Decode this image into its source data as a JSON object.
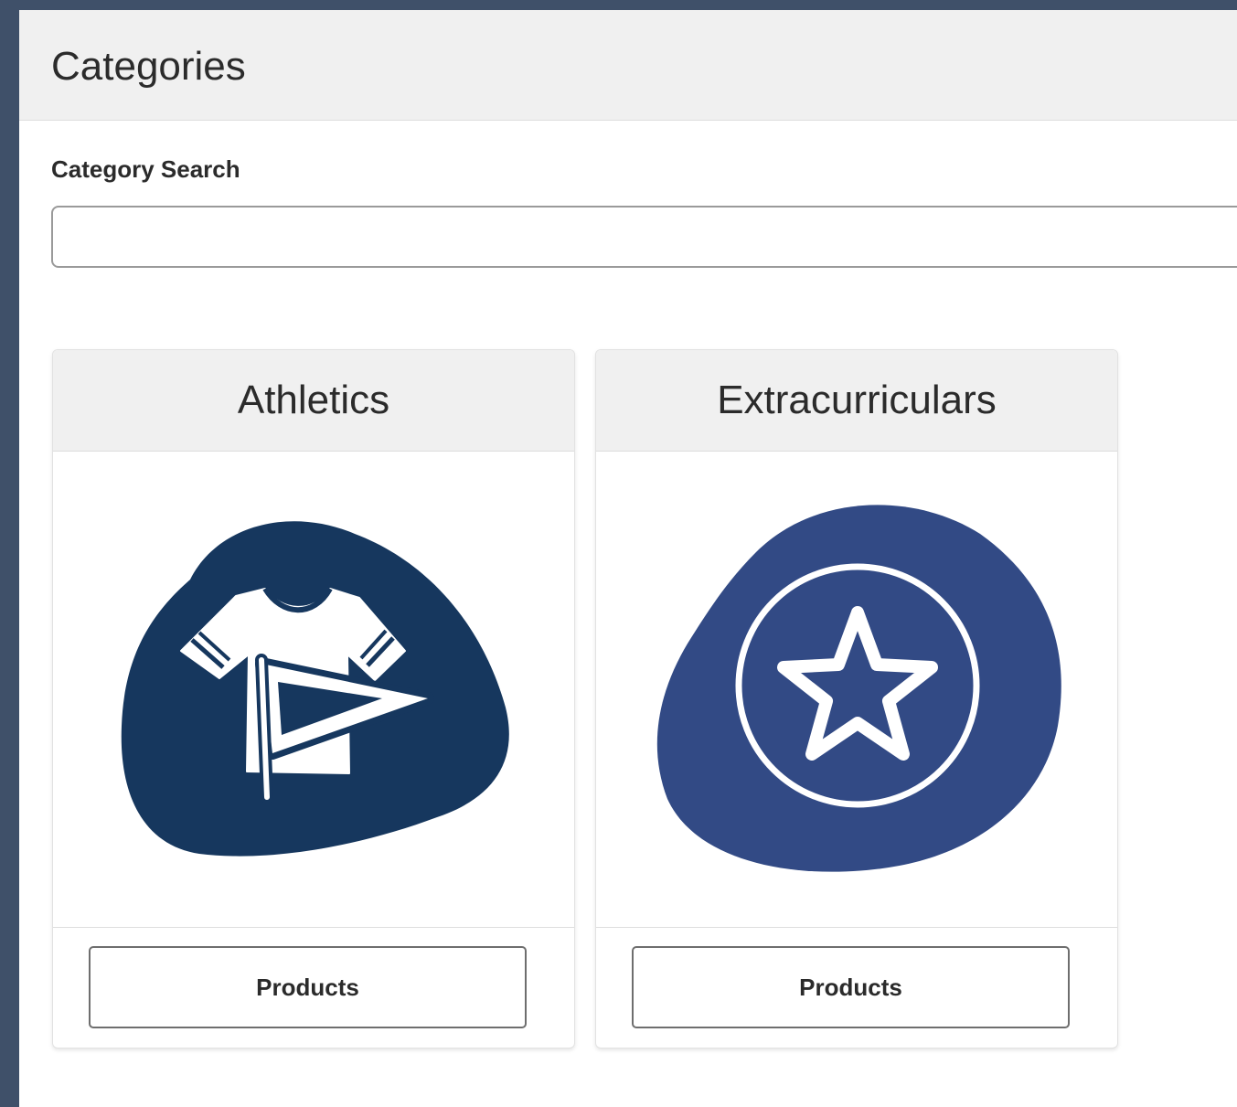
{
  "page": {
    "title": "Categories"
  },
  "search": {
    "label": "Category Search",
    "value": "",
    "placeholder": ""
  },
  "categories": [
    {
      "title": "Athletics",
      "icon": "jersey-pennant-icon",
      "icon_color": "#16375e",
      "button_label": "Products"
    },
    {
      "title": "Extracurriculars",
      "icon": "star-badge-icon",
      "icon_color": "#324a85",
      "button_label": "Products"
    }
  ],
  "colors": {
    "frame": "#3f5069",
    "header_bg": "#f0f0f0",
    "text": "#2b2b2b"
  }
}
